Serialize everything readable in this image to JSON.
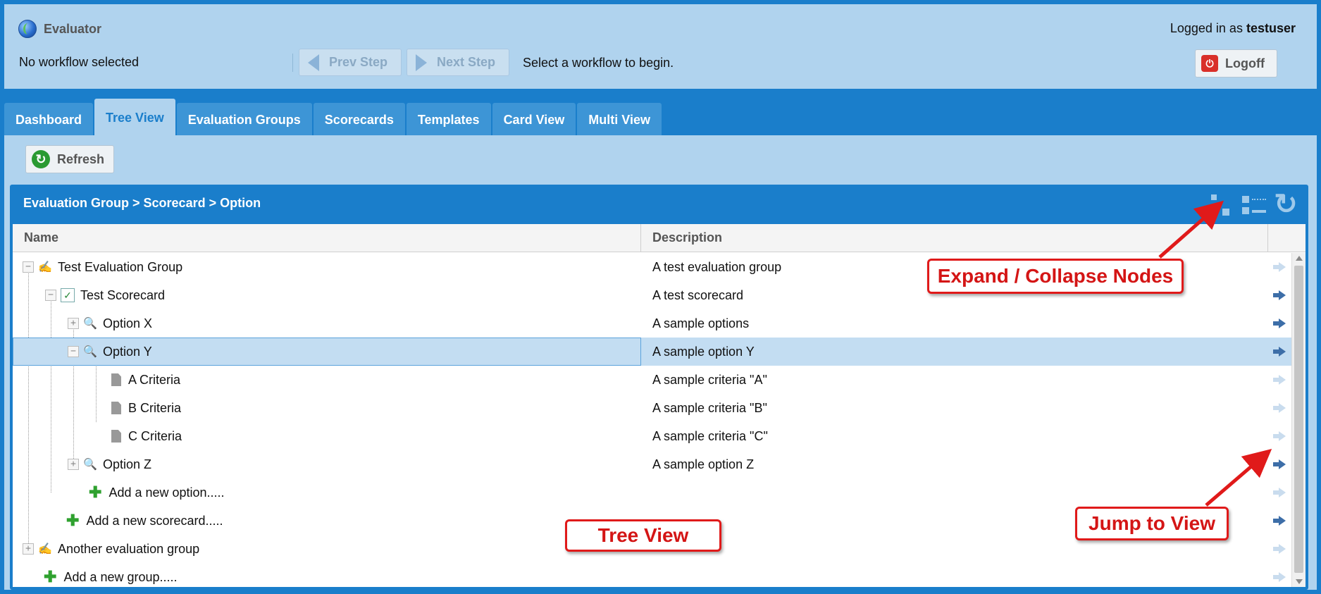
{
  "header": {
    "app_title": "Evaluator",
    "workflow_status": "No workflow selected",
    "prev_step": "Prev Step",
    "next_step": "Next Step",
    "workflow_hint": "Select a workflow to begin.",
    "login_prefix": "Logged in as",
    "username": "testuser",
    "logoff": "Logoff"
  },
  "tabs": [
    {
      "label": "Dashboard"
    },
    {
      "label": "Tree View"
    },
    {
      "label": "Evaluation Groups"
    },
    {
      "label": "Scorecards"
    },
    {
      "label": "Templates"
    },
    {
      "label": "Card View"
    },
    {
      "label": "Multi View"
    }
  ],
  "toolbar": {
    "refresh": "Refresh"
  },
  "panel": {
    "title": "Evaluation Group > Scorecard > Option",
    "columns": {
      "name": "Name",
      "description": "Description"
    }
  },
  "rows": [
    {
      "name": "Test Evaluation Group",
      "description": "A test evaluation group"
    },
    {
      "name": "Test Scorecard",
      "description": "A test scorecard"
    },
    {
      "name": "Option X",
      "description": "A sample options"
    },
    {
      "name": "Option Y",
      "description": "A sample option Y"
    },
    {
      "name": "A Criteria",
      "description": "A sample criteria \"A\""
    },
    {
      "name": "B Criteria",
      "description": "A sample criteria \"B\""
    },
    {
      "name": "C Criteria",
      "description": "A sample criteria \"C\""
    },
    {
      "name": "Option Z",
      "description": "A sample option Z"
    },
    {
      "name": "Add a new option.....",
      "description": ""
    },
    {
      "name": "Add a new scorecard.....",
      "description": ""
    },
    {
      "name": "Another evaluation group",
      "description": ""
    },
    {
      "name": "Add a new group.....",
      "description": ""
    }
  ],
  "callouts": {
    "expand_collapse": "Expand / Collapse Nodes",
    "jump_to_view": "Jump to View",
    "tree_view": "Tree View"
  }
}
